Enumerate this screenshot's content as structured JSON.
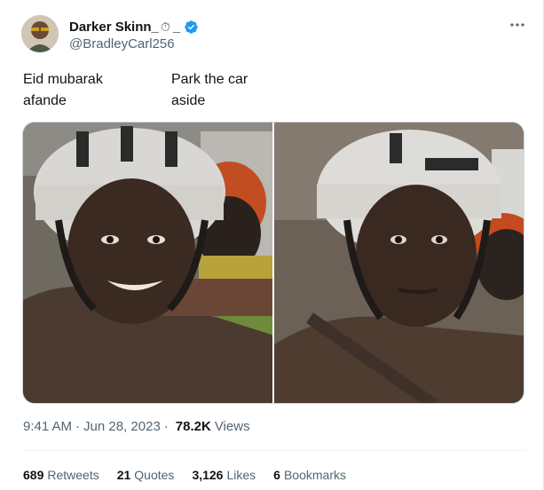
{
  "author": {
    "display_name": "Darker Skinn_",
    "name_emoji": "⏱",
    "name_suffix": "_",
    "handle": "@BradleyCarl256",
    "verified": true
  },
  "tweet": {
    "caption_left": "Eid mubarak\nafande",
    "caption_right": "Park the car\naside"
  },
  "meta": {
    "time": "9:41 AM",
    "separator": "·",
    "date": "Jun 28, 2023",
    "views_count": "78.2K",
    "views_label": "Views"
  },
  "stats": {
    "retweets_count": "689",
    "retweets_label": "Retweets",
    "quotes_count": "21",
    "quotes_label": "Quotes",
    "likes_count": "3,126",
    "likes_label": "Likes",
    "bookmarks_count": "6",
    "bookmarks_label": "Bookmarks"
  },
  "icons": {
    "verified": "verified-badge-icon",
    "more": "more-options-icon"
  },
  "colors": {
    "verified_blue": "#1d9bf0",
    "secondary_text": "#536471",
    "primary_text": "#0f1419"
  }
}
